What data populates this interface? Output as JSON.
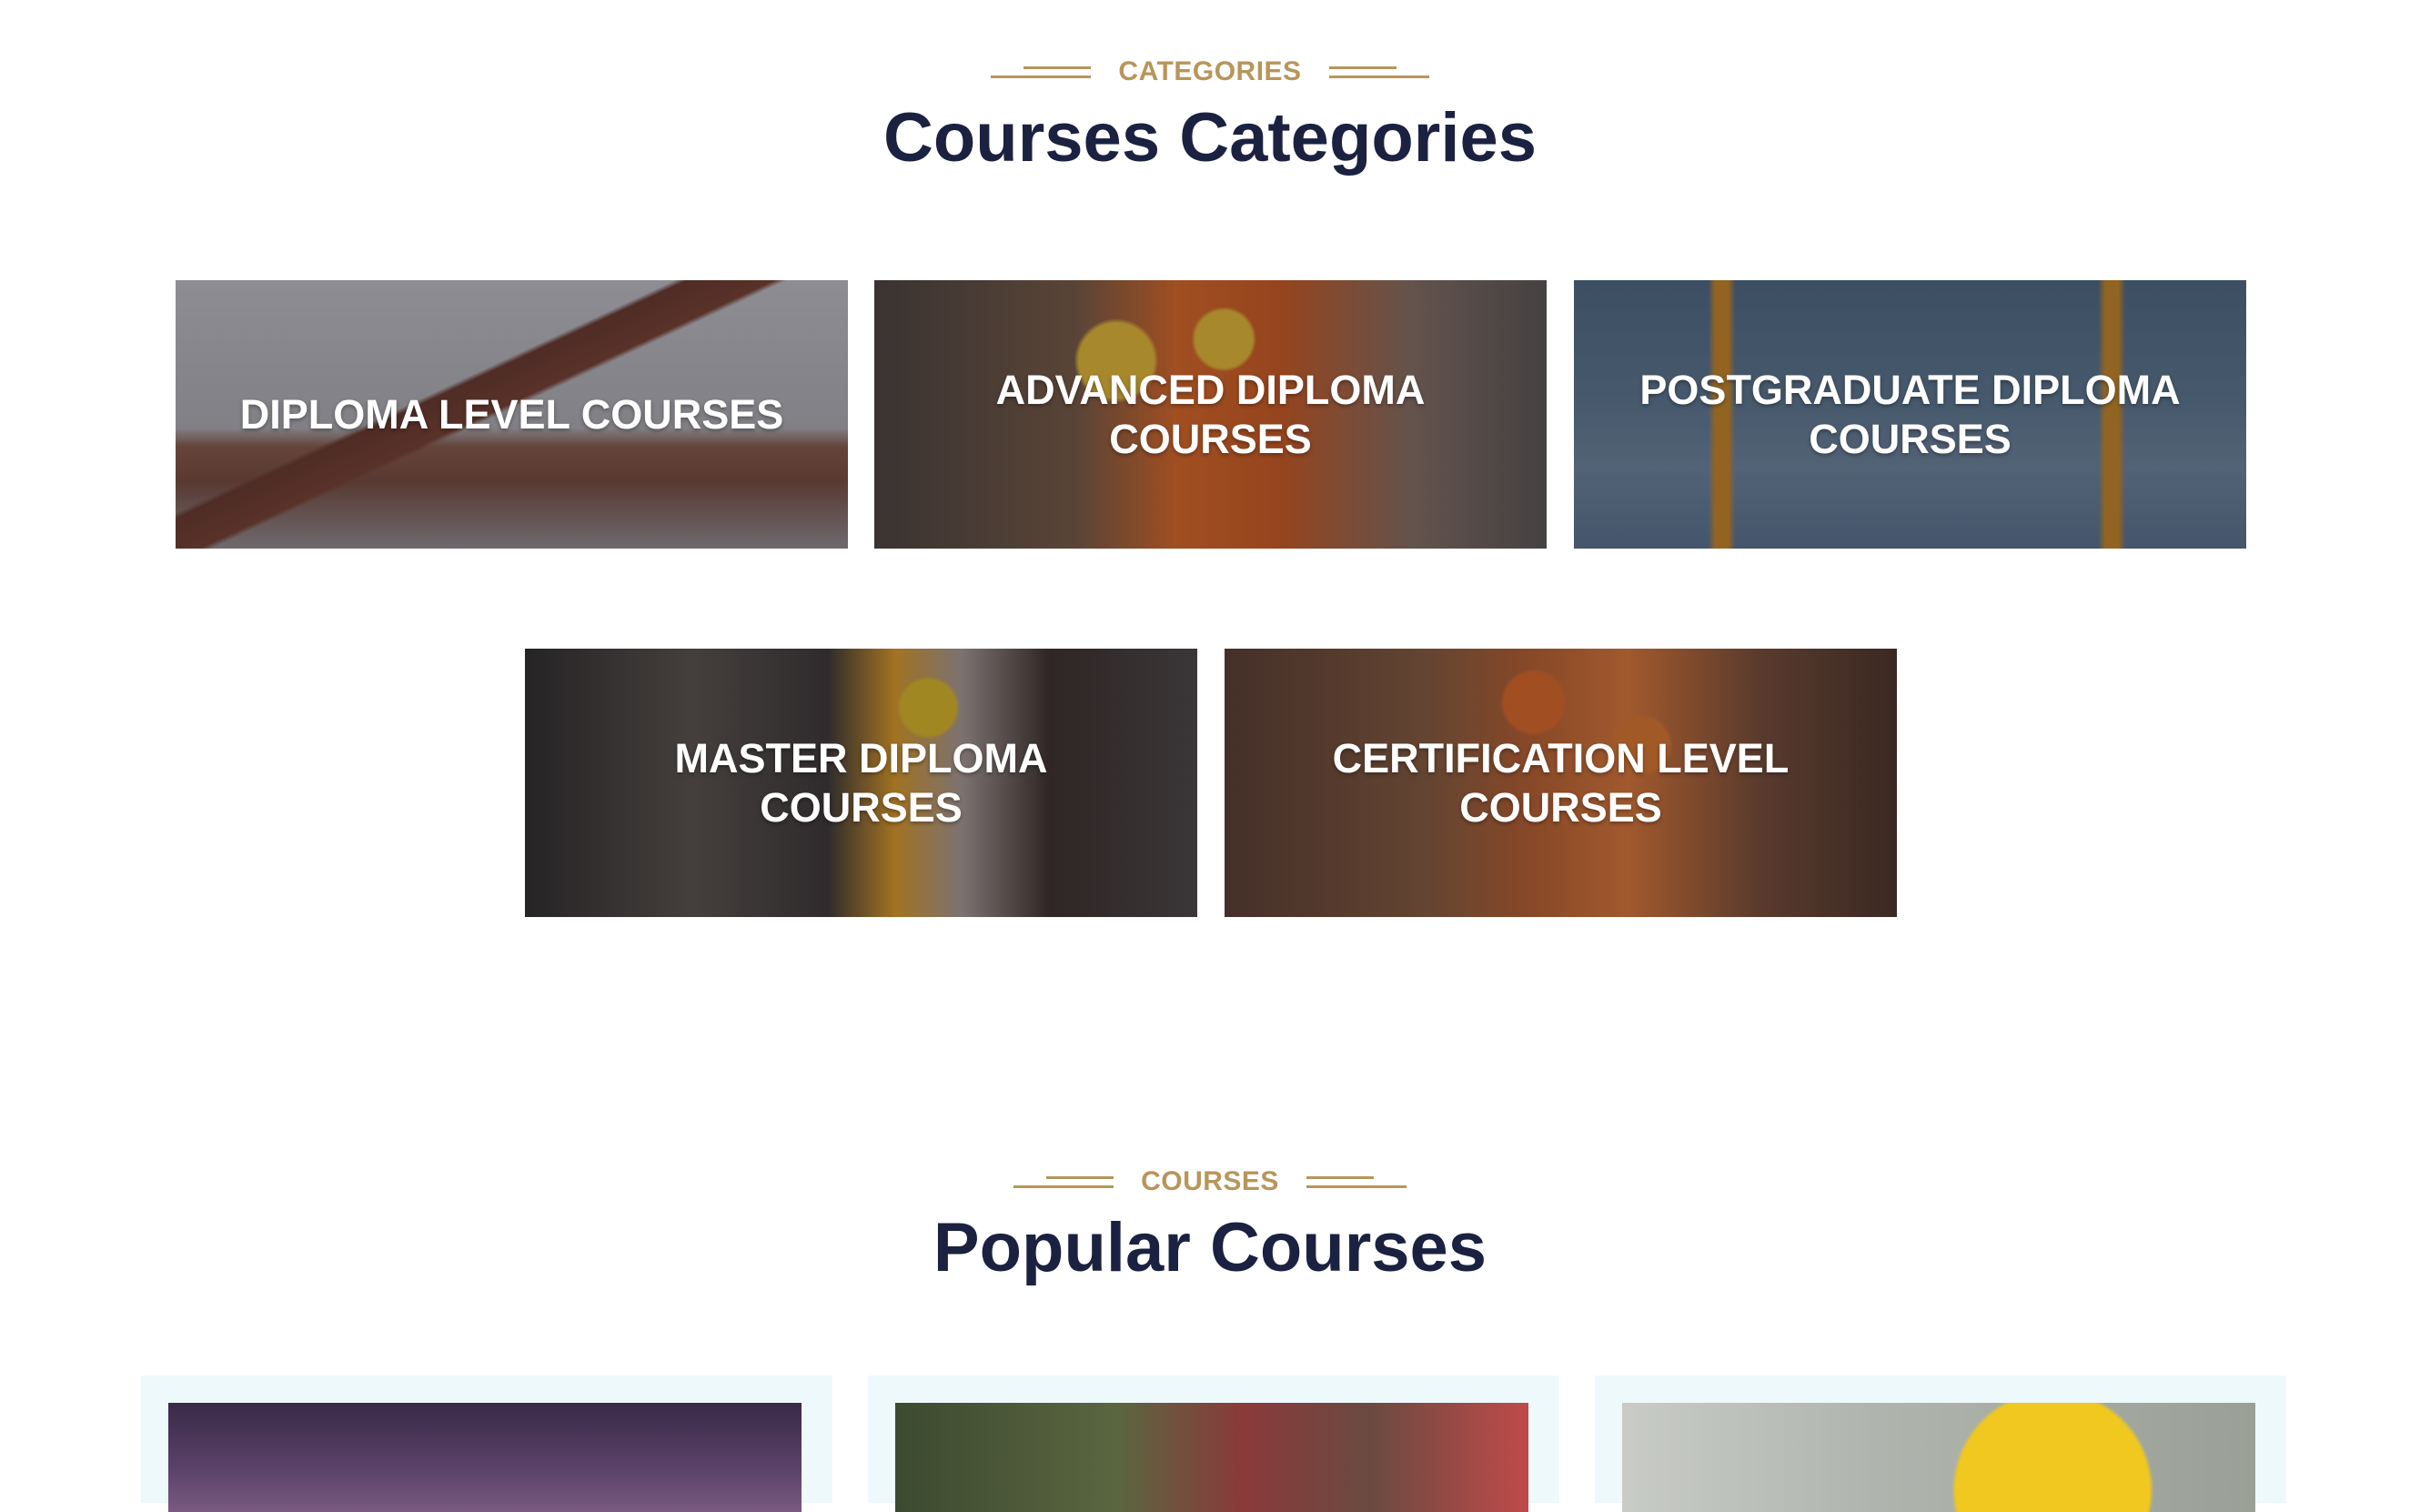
{
  "categories_section": {
    "eyebrow": "CATEGORIES",
    "title": "Courses Categories",
    "cards": [
      {
        "label": "DIPLOMA LEVEL COURSES"
      },
      {
        "label": "ADVANCED DIPLOMA COURSES"
      },
      {
        "label": "POSTGRADUATE DIPLOMA COURSES"
      },
      {
        "label": "MASTER DIPLOMA COURSES"
      },
      {
        "label": "CERTIFICATION LEVEL COURSES"
      }
    ]
  },
  "courses_section": {
    "eyebrow": "COURSES",
    "title": "Popular Courses"
  },
  "colors": {
    "accent": "#b8955a",
    "heading": "#1b2140",
    "card_bg": "#eef9fb"
  }
}
